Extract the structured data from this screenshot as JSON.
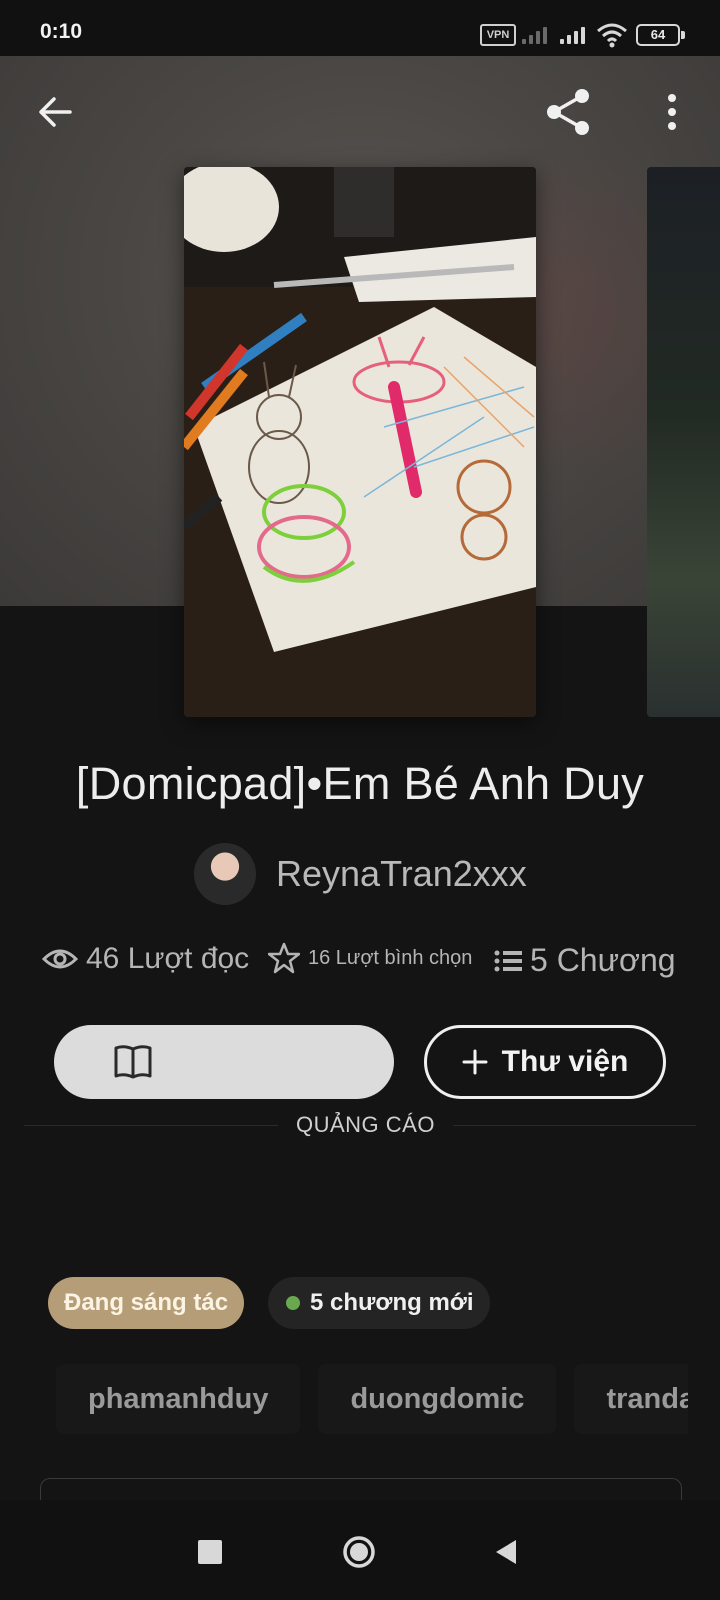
{
  "status_bar": {
    "time": "0:10",
    "vpn_label": "VPN",
    "battery": "64"
  },
  "icons": {
    "back": "arrow-left-icon",
    "share": "share-icon",
    "more": "more-vertical-icon",
    "reads": "eye-icon",
    "votes": "star-icon",
    "chapters": "list-icon",
    "read": "book-open-icon",
    "library_add": "plus-icon"
  },
  "story": {
    "title": "[Domicpad]•Em Bé Anh Duy",
    "author": "ReynaTran2xxx",
    "reads": "46 Lượt đọc",
    "votes": "16 Lượt bình chọn",
    "chapters": "5 Chương"
  },
  "actions": {
    "read_label": "",
    "library_label": "Thư viện"
  },
  "ad": {
    "label": "QUẢNG CÁO"
  },
  "badges": {
    "status": "Đang sáng tác",
    "new_chapters": "5 chương mới"
  },
  "tags": [
    "phamanhduy",
    "duongdomic",
    "trandan"
  ],
  "colors": {
    "background": "#141414",
    "status_badge": "#b59e77",
    "new_dot": "#6aa84f"
  }
}
